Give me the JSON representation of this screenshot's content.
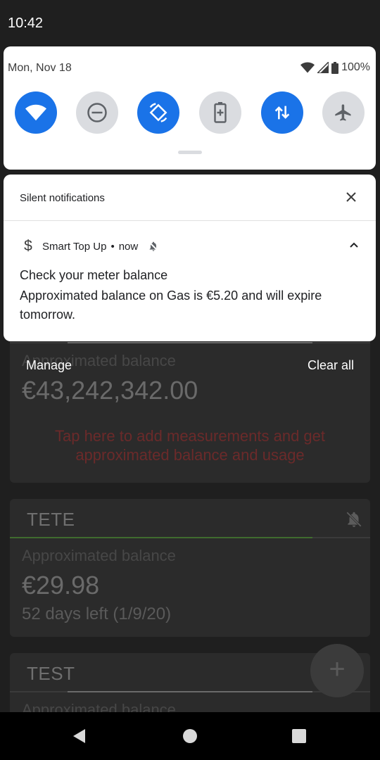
{
  "status_bar": {
    "time": "10:42"
  },
  "quick_settings": {
    "date": "Mon, Nov 18",
    "battery_pct": "100%",
    "tiles": [
      {
        "name": "wifi",
        "on": true
      },
      {
        "name": "do-not-disturb",
        "on": false
      },
      {
        "name": "auto-rotate",
        "on": true
      },
      {
        "name": "battery-saver",
        "on": false
      },
      {
        "name": "mobile-data",
        "on": true
      },
      {
        "name": "airplane-mode",
        "on": false
      }
    ]
  },
  "shade": {
    "section_title": "Silent notifications",
    "notification": {
      "app_icon": "dollar-icon",
      "app_name": "Smart Top Up",
      "separator": "•",
      "time": "now",
      "title": "Check your meter balance",
      "body": "Approximated balance on Gas is €5.20 and will expire tomorrow."
    },
    "manage_label": "Manage",
    "clear_all_label": "Clear all"
  },
  "background_app": {
    "card1": {
      "label": "Approximated balance",
      "amount": "€43,242,342.00",
      "message": "Tap here to add measurements and get approximated balance and usage"
    },
    "card2": {
      "title": "TETE",
      "label": "Approximated balance",
      "amount": "€29.98",
      "days_left": "52 days left (1/9/20)"
    },
    "card3": {
      "title": "TEST",
      "label": "Approximated balance"
    },
    "fab_label": "+"
  },
  "nav_bar": {
    "back": "back-icon",
    "home": "home-icon",
    "recents": "recents-icon"
  }
}
